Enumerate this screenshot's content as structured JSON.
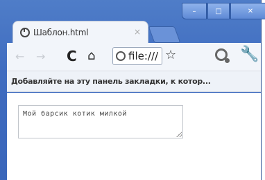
{
  "window": {
    "minimize_icon": "minimize-icon",
    "maximize_icon": "maximize-icon",
    "close_icon": "close-icon",
    "minimize_glyph": "–",
    "maximize_glyph": "□",
    "close_glyph": "✕"
  },
  "tab": {
    "title": "Шаблон.html",
    "close_glyph": "×"
  },
  "toolbar": {
    "back_glyph": "←",
    "forward_glyph": "→",
    "reload_glyph": "C",
    "home_glyph": "⌂",
    "url": "file:///",
    "star_glyph": "☆",
    "wrench_glyph": "🔧"
  },
  "bookmarks": {
    "hint": "Добавляйте на эту панель закладки, к котор..."
  },
  "content": {
    "textarea_value": "Мой барсик котик милкой"
  }
}
